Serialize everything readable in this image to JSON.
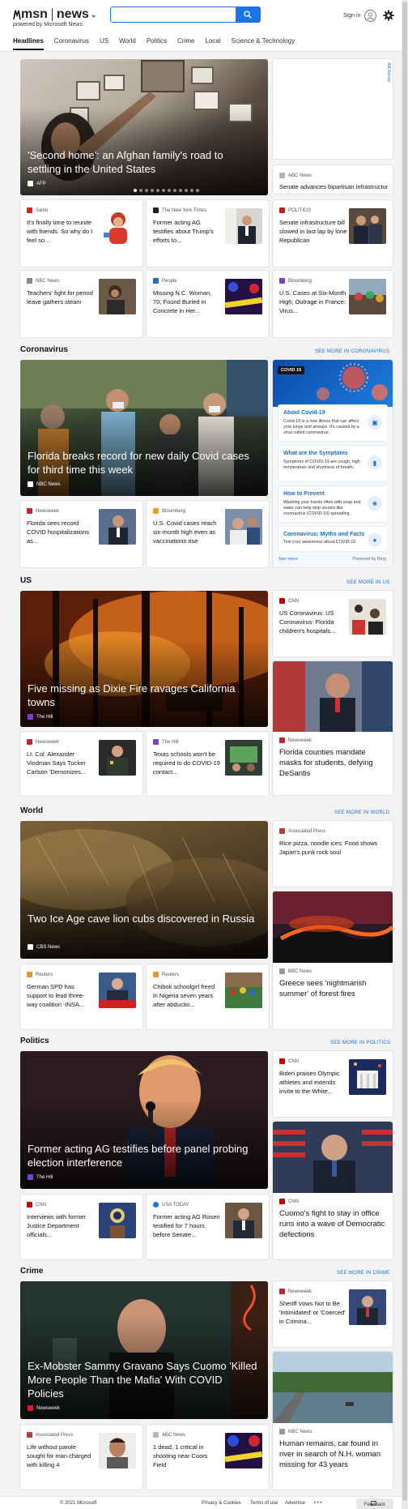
{
  "header": {
    "brand_left": "msn",
    "brand_right": "news",
    "powered_by": "powered by Microsoft News",
    "search_placeholder": "",
    "sign_in": "Sign in"
  },
  "nav": [
    "Headlines",
    "Coronavirus",
    "US",
    "World",
    "Politics",
    "Crime",
    "Local",
    "Science & Technology"
  ],
  "top": {
    "hero": {
      "title": "'Second home': an Afghan family's road to settling in the United States",
      "source": "AFP"
    },
    "ad_label": "AdChoices",
    "side": {
      "source": "ABC News",
      "title": "Senate advances bipartisan infrastructur..."
    },
    "row1": [
      {
        "source": "Salon",
        "title": "It's finally time to reunite with friends. So why do I feel so..."
      },
      {
        "source": "The New York Times",
        "title": "Former acting AG testifies about Trump's efforts to..."
      },
      {
        "source": "POLITICO",
        "title": "Senate infrastructure bill slowed in last lap by lone Republican"
      }
    ],
    "row2": [
      {
        "source": "NBC News",
        "title": "Teachers' fight for period leave gathers steam"
      },
      {
        "source": "People",
        "title": "Missing N.C. Woman, 70, Found Buried in Concrete in Her..."
      },
      {
        "source": "Bloomberg",
        "title": "U.S. Cases at Six-Month High; Outrage in France: Virus..."
      }
    ]
  },
  "coronavirus": {
    "heading": "Coronavirus",
    "see_more": "SEE MORE IN CORONAVIRUS",
    "hero": {
      "title": "Florida breaks record for new daily Covid cases for third time this week",
      "source": "NBC News"
    },
    "cards": [
      {
        "source": "Newsweek",
        "title": "Florida sees record COVID hospitalizations as..."
      },
      {
        "source": "Bloomberg",
        "title": "U.S. Covid cases reach six-month high even as vaccinations rise"
      }
    ],
    "widget": {
      "badge": "COVID 19",
      "items": [
        {
          "title": "About Covid-19",
          "desc": "Covid-19 is a new illness that can affect your lungs and airways. It's caused by a virus called coronavirus."
        },
        {
          "title": "What are the Symptoms",
          "desc": "Symptoms of COVID-19 are cough, high temperature and shortness of breath."
        },
        {
          "title": "How to Prevent",
          "desc": "Washing your hands often with soap and water can help stop viruses like coronavirus (COVID-19) spreading."
        },
        {
          "title": "Coronavirus: Myths and Facts",
          "desc": "Test your awareness about COVID-19."
        }
      ],
      "see_more": "See more",
      "powered": "Powered by Bing"
    }
  },
  "us": {
    "heading": "US",
    "see_more": "SEE MORE IN US",
    "hero": {
      "title": "Five missing as Dixie Fire ravages California towns",
      "source": "The Hill"
    },
    "side_top": {
      "source": "CNN",
      "title": "US Coronavirus: US Coronavirus: Florida children's hospitals..."
    },
    "side_big": {
      "source": "Newsweek",
      "title": "Florida counties mandate masks for students, defying DeSantis"
    },
    "cards": [
      {
        "source": "Newsweek",
        "title": "Lt. Col. Alexander Vindman Says Tucker Carlson 'Demonizes..."
      },
      {
        "source": "The Hill",
        "title": "Texas schools won't be required to do COVID-19 contact..."
      }
    ]
  },
  "world": {
    "heading": "World",
    "see_more": "SEE MORE IN WORLD",
    "hero": {
      "title": "Two Ice Age cave lion cubs discovered in Russia",
      "source": "CBS News"
    },
    "side_top": {
      "source": "Associated Press",
      "title": "Rice pizza, noodle ices: Food shows Japan's punk rock soul"
    },
    "side_big": {
      "source": "BBC News",
      "title": "Greece sees 'nightmarish summer' of forest fires"
    },
    "cards": [
      {
        "source": "Reuters",
        "title": "German SPD has support to lead three-way coalition -INSA..."
      },
      {
        "source": "Reuters",
        "title": "Chibok schoolgirl freed in Nigeria seven years after abductio..."
      }
    ]
  },
  "politics": {
    "heading": "Politics",
    "see_more": "SEE MORE IN POLITICS",
    "hero": {
      "title": "Former acting AG testifies before panel probing election interference",
      "source": "The Hill"
    },
    "side_top": {
      "source": "CNN",
      "title": "Biden praises Olympic athletes and extends invite to the White..."
    },
    "side_big": {
      "source": "CNN",
      "title": "Cuomo's fight to stay in office runs into a wave of Democratic defections"
    },
    "cards": [
      {
        "source": "CNN",
        "title": "Interviews with former Justice Department officials..."
      },
      {
        "source": "USA TODAY",
        "title": "Former acting AG Rosen testified for 7 hours before Senate..."
      }
    ]
  },
  "crime": {
    "heading": "Crime",
    "see_more": "SEE MORE IN CRIME",
    "hero": {
      "title": "Ex-Mobster Sammy Gravano Says Cuomo 'Killed More People Than the Mafia' With COVID Policies",
      "source": "Newsweek"
    },
    "side_top": {
      "source": "Newsweek",
      "title": "Sheriff Vows Not to Be 'Intimidated' or 'Coerced' in Crimina..."
    },
    "side_big": {
      "source": "NBC News",
      "title": "Human remains, car found in river in search of N.H. woman missing for 43 years"
    },
    "cards": [
      {
        "source": "Associated Press",
        "title": "Life without parole sought for man charged with killing 4"
      },
      {
        "source": "ABC News",
        "title": "1 dead, 1 critical in shooting near Coors Field"
      }
    ]
  },
  "footer": {
    "copyright": "© 2021 Microsoft",
    "privacy": "Privacy & Cookies",
    "terms": "Terms of use",
    "advertise": "Advertise",
    "more": "• • •",
    "feedback": "Feedback"
  }
}
